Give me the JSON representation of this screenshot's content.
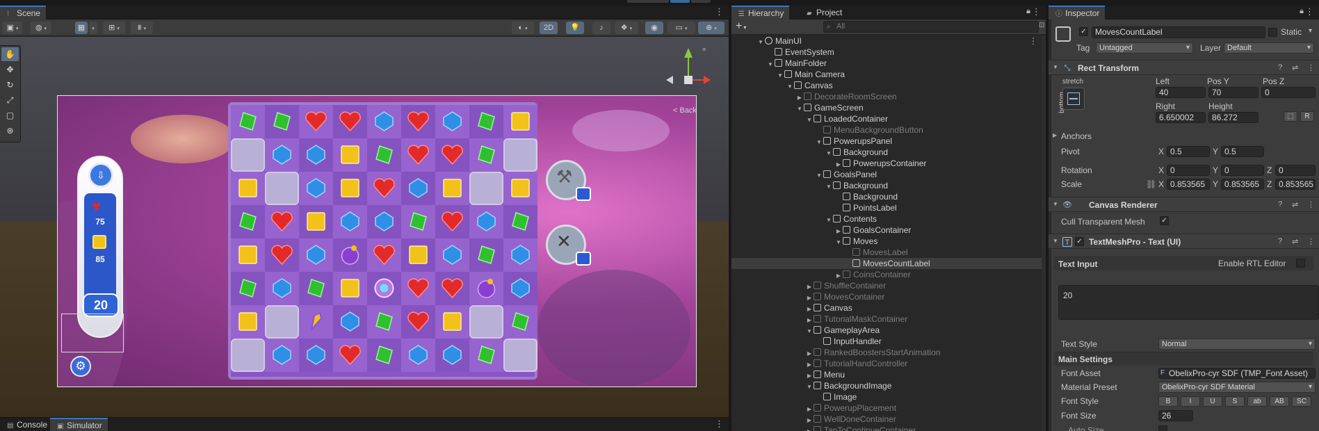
{
  "scene": {
    "tab_label": "Scene",
    "mode_2d": "2D",
    "back_label": "< Back",
    "moves_badge": "20",
    "goal_counts": [
      "75",
      "85"
    ],
    "bottom_tabs": [
      "Console",
      "Simulator"
    ]
  },
  "board": {
    "columns": 9,
    "rows": 8,
    "grid": [
      [
        "G",
        "G",
        "R",
        "R",
        "B",
        "R",
        "B",
        "G",
        "Y"
      ],
      [
        "X",
        "B",
        "B",
        "Y",
        "G",
        "R",
        "R",
        "G",
        "X"
      ],
      [
        "Y",
        "X",
        "B",
        "Y",
        "R",
        "B",
        "Y",
        "X",
        "Y"
      ],
      [
        "G",
        "R",
        "Y",
        "B",
        "B",
        "G",
        "R",
        "B",
        "G"
      ],
      [
        "Y",
        "R",
        "B",
        "P",
        "R",
        "Y",
        "B",
        "G",
        "B"
      ],
      [
        "G",
        "B",
        "G",
        "Y",
        "S",
        "R",
        "R",
        "P",
        "B"
      ],
      [
        "Y",
        "X",
        "C",
        "B",
        "G",
        "R",
        "Y",
        "X",
        "G"
      ],
      [
        "X",
        "B",
        "B",
        "R",
        "G",
        "B",
        "B",
        "G",
        "X"
      ]
    ],
    "gem_colors": {
      "G": "#2fbf2f",
      "R": "#e22a2a",
      "B": "#2f8fe6",
      "Y": "#f2c21a",
      "P": "#8b3fd1",
      "S": "#b07be0",
      "C": "#8a52d6"
    }
  },
  "hierarchy": {
    "tab_label": "Hierarchy",
    "project_tab_label": "Project",
    "search_placeholder": "All",
    "rows": [
      {
        "label": "MainUI",
        "depth": 0,
        "arrow": "▼",
        "faded": false,
        "unity": true
      },
      {
        "label": "EventSystem",
        "depth": 1,
        "arrow": "",
        "faded": false
      },
      {
        "label": "MainFolder",
        "depth": 1,
        "arrow": "▼",
        "faded": false
      },
      {
        "label": "Main Camera",
        "depth": 2,
        "arrow": "▼",
        "faded": false
      },
      {
        "label": "Canvas",
        "depth": 3,
        "arrow": "▼",
        "faded": false
      },
      {
        "label": "DecorateRoomScreen",
        "depth": 4,
        "arrow": "▶",
        "faded": true
      },
      {
        "label": "GameScreen",
        "depth": 4,
        "arrow": "▼",
        "faded": false
      },
      {
        "label": "LoadedContainer",
        "depth": 5,
        "arrow": "▼",
        "faded": false
      },
      {
        "label": "MenuBackgroundButton",
        "depth": 6,
        "arrow": "",
        "faded": true
      },
      {
        "label": "PowerupsPanel",
        "depth": 6,
        "arrow": "▼",
        "faded": false
      },
      {
        "label": "Background",
        "depth": 7,
        "arrow": "▼",
        "faded": false
      },
      {
        "label": "PowerupsContainer",
        "depth": 8,
        "arrow": "▶",
        "faded": false
      },
      {
        "label": "GoalsPanel",
        "depth": 6,
        "arrow": "▼",
        "faded": false
      },
      {
        "label": "Background",
        "depth": 7,
        "arrow": "▼",
        "faded": false
      },
      {
        "label": "Background",
        "depth": 8,
        "arrow": "",
        "faded": false
      },
      {
        "label": "PointsLabel",
        "depth": 8,
        "arrow": "",
        "faded": false
      },
      {
        "label": "Contents",
        "depth": 7,
        "arrow": "▼",
        "faded": false
      },
      {
        "label": "GoalsContainer",
        "depth": 8,
        "arrow": "▶",
        "faded": false
      },
      {
        "label": "Moves",
        "depth": 8,
        "arrow": "▼",
        "faded": false
      },
      {
        "label": "MovesLabel",
        "depth": 9,
        "arrow": "",
        "faded": true
      },
      {
        "label": "MovesCountLabel",
        "depth": 9,
        "arrow": "",
        "faded": false,
        "selected": true
      },
      {
        "label": "CoinsContainer",
        "depth": 8,
        "arrow": "▶",
        "faded": true
      },
      {
        "label": "ShuffleContainer",
        "depth": 5,
        "arrow": "▶",
        "faded": true
      },
      {
        "label": "MovesContainer",
        "depth": 5,
        "arrow": "▶",
        "faded": true
      },
      {
        "label": "Canvas",
        "depth": 5,
        "arrow": "▶",
        "faded": false
      },
      {
        "label": "TutorialMaskContainer",
        "depth": 5,
        "arrow": "▶",
        "faded": true
      },
      {
        "label": "GameplayArea",
        "depth": 5,
        "arrow": "▼",
        "faded": false
      },
      {
        "label": "InputHandler",
        "depth": 6,
        "arrow": "",
        "faded": false
      },
      {
        "label": "RankedBoostersStartAnimation",
        "depth": 5,
        "arrow": "▶",
        "faded": true
      },
      {
        "label": "TutorialHandController",
        "depth": 5,
        "arrow": "▶",
        "faded": true
      },
      {
        "label": "Menu",
        "depth": 5,
        "arrow": "▶",
        "faded": false
      },
      {
        "label": "BackgroundImage",
        "depth": 5,
        "arrow": "▼",
        "faded": false
      },
      {
        "label": "Image",
        "depth": 6,
        "arrow": "",
        "faded": false
      },
      {
        "label": "PowerupPlacement",
        "depth": 5,
        "arrow": "▶",
        "faded": true
      },
      {
        "label": "WellDoneContainer",
        "depth": 5,
        "arrow": "▶",
        "faded": true
      },
      {
        "label": "TapToContinueContainer",
        "depth": 5,
        "arrow": "▶",
        "faded": true
      }
    ]
  },
  "inspector": {
    "tab_label": "Inspector",
    "object_name": "MovesCountLabel",
    "static_label": "Static",
    "tag_label": "Tag",
    "tag_value": "Untagged",
    "layer_label": "Layer",
    "layer_value": "Default",
    "rect_transform": {
      "title": "Rect Transform",
      "anchor_preset_h": "stretch",
      "anchor_preset_v": "bottom",
      "left_label": "Left",
      "left_value": "40",
      "posy_label": "Pos Y",
      "posy_value": "70",
      "posz_label": "Pos Z",
      "posz_value": "0",
      "right_label": "Right",
      "right_value": "6.650002",
      "height_label": "Height",
      "height_value": "86.272",
      "r_button": "R",
      "anchors_label": "Anchors",
      "pivot_label": "Pivot",
      "pivot_x": "0.5",
      "pivot_y": "0.5",
      "rotation_label": "Rotation",
      "rot_x": "0",
      "rot_y": "0",
      "rot_z": "0",
      "scale_label": "Scale",
      "scale_x": "0.853565",
      "scale_y": "0.853565",
      "scale_z": "0.853565",
      "x": "X",
      "y": "Y",
      "z": "Z"
    },
    "canvas_renderer": {
      "title": "Canvas Renderer",
      "cull_label": "Cull Transparent Mesh"
    },
    "tmp": {
      "title": "TextMeshPro - Text (UI)",
      "text_input_label": "Text Input",
      "rtl_label": "Enable RTL Editor",
      "text_value": "20",
      "text_style_label": "Text Style",
      "text_style_value": "Normal",
      "main_settings_label": "Main Settings",
      "font_asset_label": "Font Asset",
      "font_asset_value": "ObelixPro-cyr SDF (TMP_Font Asset)",
      "material_preset_label": "Material Preset",
      "material_preset_value": "ObelixPro-cyr SDF Material",
      "font_style_label": "Font Style",
      "font_style_buttons": [
        "B",
        "I",
        "U",
        "S",
        "ab",
        "AB",
        "SC"
      ],
      "font_size_label": "Font Size",
      "font_size_value": "26",
      "auto_size_label": "Auto Size"
    }
  },
  "colors": {
    "accent": "#3a79bb",
    "panel": "#282828",
    "inspector": "#3c3c3c"
  }
}
